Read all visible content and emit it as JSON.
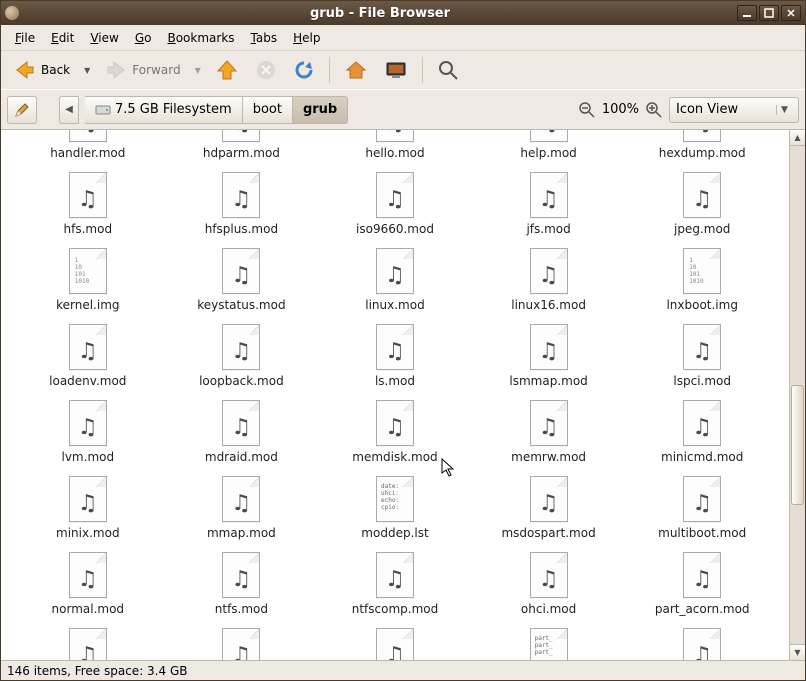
{
  "window": {
    "title": "grub - File Browser"
  },
  "menu": {
    "file": "File",
    "edit": "Edit",
    "view": "View",
    "go": "Go",
    "bookmarks": "Bookmarks",
    "tabs": "Tabs",
    "help": "Help"
  },
  "toolbar": {
    "back": "Back",
    "forward": "Forward"
  },
  "breadcrumb": {
    "drive": "7.5 GB Filesystem",
    "b1": "boot",
    "b2": "grub"
  },
  "zoom": {
    "pct": "100%"
  },
  "view_select": {
    "label": "Icon View"
  },
  "status": {
    "text": "146 items, Free space: 3.4 GB"
  },
  "icons": {
    "bin_text": "1\n10\n101\n1010",
    "lst_text": "date:\nuhci:\necho:\ncpio:",
    "part_text": "part_\npart_\npart_"
  },
  "files": [
    {
      "name": "handler.mod",
      "type": "mod",
      "row": "partial"
    },
    {
      "name": "hdparm.mod",
      "type": "mod",
      "row": "partial"
    },
    {
      "name": "hello.mod",
      "type": "mod",
      "row": "partial"
    },
    {
      "name": "help.mod",
      "type": "mod",
      "row": "partial"
    },
    {
      "name": "hexdump.mod",
      "type": "mod",
      "row": "partial"
    },
    {
      "name": "hfs.mod",
      "type": "mod"
    },
    {
      "name": "hfsplus.mod",
      "type": "mod"
    },
    {
      "name": "iso9660.mod",
      "type": "mod"
    },
    {
      "name": "jfs.mod",
      "type": "mod"
    },
    {
      "name": "jpeg.mod",
      "type": "mod"
    },
    {
      "name": "kernel.img",
      "type": "img"
    },
    {
      "name": "keystatus.mod",
      "type": "mod"
    },
    {
      "name": "linux.mod",
      "type": "mod"
    },
    {
      "name": "linux16.mod",
      "type": "mod"
    },
    {
      "name": "lnxboot.img",
      "type": "img"
    },
    {
      "name": "loadenv.mod",
      "type": "mod"
    },
    {
      "name": "loopback.mod",
      "type": "mod"
    },
    {
      "name": "ls.mod",
      "type": "mod"
    },
    {
      "name": "lsmmap.mod",
      "type": "mod"
    },
    {
      "name": "lspci.mod",
      "type": "mod"
    },
    {
      "name": "lvm.mod",
      "type": "mod"
    },
    {
      "name": "mdraid.mod",
      "type": "mod"
    },
    {
      "name": "memdisk.mod",
      "type": "mod"
    },
    {
      "name": "memrw.mod",
      "type": "mod"
    },
    {
      "name": "minicmd.mod",
      "type": "mod"
    },
    {
      "name": "minix.mod",
      "type": "mod"
    },
    {
      "name": "mmap.mod",
      "type": "mod"
    },
    {
      "name": "moddep.lst",
      "type": "lst"
    },
    {
      "name": "msdospart.mod",
      "type": "mod"
    },
    {
      "name": "multiboot.mod",
      "type": "mod"
    },
    {
      "name": "normal.mod",
      "type": "mod"
    },
    {
      "name": "ntfs.mod",
      "type": "mod"
    },
    {
      "name": "ntfscomp.mod",
      "type": "mod"
    },
    {
      "name": "ohci.mod",
      "type": "mod"
    },
    {
      "name": "part_acorn.mod",
      "type": "mod"
    },
    {
      "name": "",
      "type": "mod",
      "row": "bottom"
    },
    {
      "name": "",
      "type": "mod",
      "row": "bottom"
    },
    {
      "name": "",
      "type": "mod",
      "row": "bottom"
    },
    {
      "name": "",
      "type": "part",
      "row": "bottom"
    },
    {
      "name": "",
      "type": "mod",
      "row": "bottom"
    }
  ]
}
